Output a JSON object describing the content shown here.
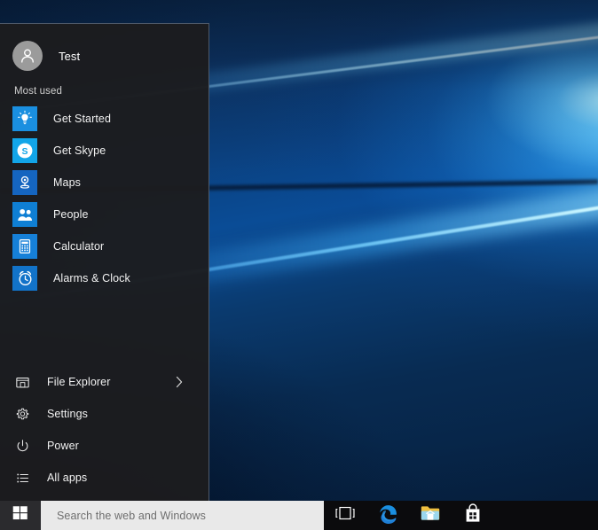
{
  "desktop": {
    "wallpaper_name": "windows-10-hero-wallpaper",
    "colors": {
      "deep_blue": "#0b2b50",
      "mid_blue": "#0a4c96",
      "bright_beam": "#8fd8ff",
      "dark_navy": "#06203f"
    }
  },
  "start_menu": {
    "user": {
      "name": "Test",
      "avatar_icon": "user-avatar-icon"
    },
    "most_used_header": "Most used",
    "most_used": [
      {
        "label": "Get Started",
        "icon": "lightbulb-icon",
        "tile_color": "#1a8fe0"
      },
      {
        "label": "Get Skype",
        "icon": "skype-icon",
        "tile_color": "#12a5e8"
      },
      {
        "label": "Maps",
        "icon": "map-pin-icon",
        "tile_color": "#1565c0"
      },
      {
        "label": "People",
        "icon": "people-icon",
        "tile_color": "#0f7fd4"
      },
      {
        "label": "Calculator",
        "icon": "calculator-icon",
        "tile_color": "#1680d8"
      },
      {
        "label": "Alarms & Clock",
        "icon": "alarm-clock-icon",
        "tile_color": "#1273c9"
      }
    ],
    "bottom_items": [
      {
        "label": "File Explorer",
        "icon": "folder-icon",
        "has_chevron": true
      },
      {
        "label": "Settings",
        "icon": "gear-icon",
        "has_chevron": false
      },
      {
        "label": "Power",
        "icon": "power-icon",
        "has_chevron": false
      },
      {
        "label": "All apps",
        "icon": "app-list-icon",
        "has_chevron": false
      }
    ]
  },
  "taskbar": {
    "start_button_icon": "windows-logo-icon",
    "search": {
      "placeholder": "Search the web and Windows",
      "value": ""
    },
    "buttons": [
      {
        "name": "task-view",
        "icon": "task-view-icon"
      },
      {
        "name": "edge",
        "icon": "edge-browser-icon"
      },
      {
        "name": "file-explorer",
        "icon": "folder-taskbar-icon"
      },
      {
        "name": "store",
        "icon": "store-bag-icon"
      }
    ]
  }
}
